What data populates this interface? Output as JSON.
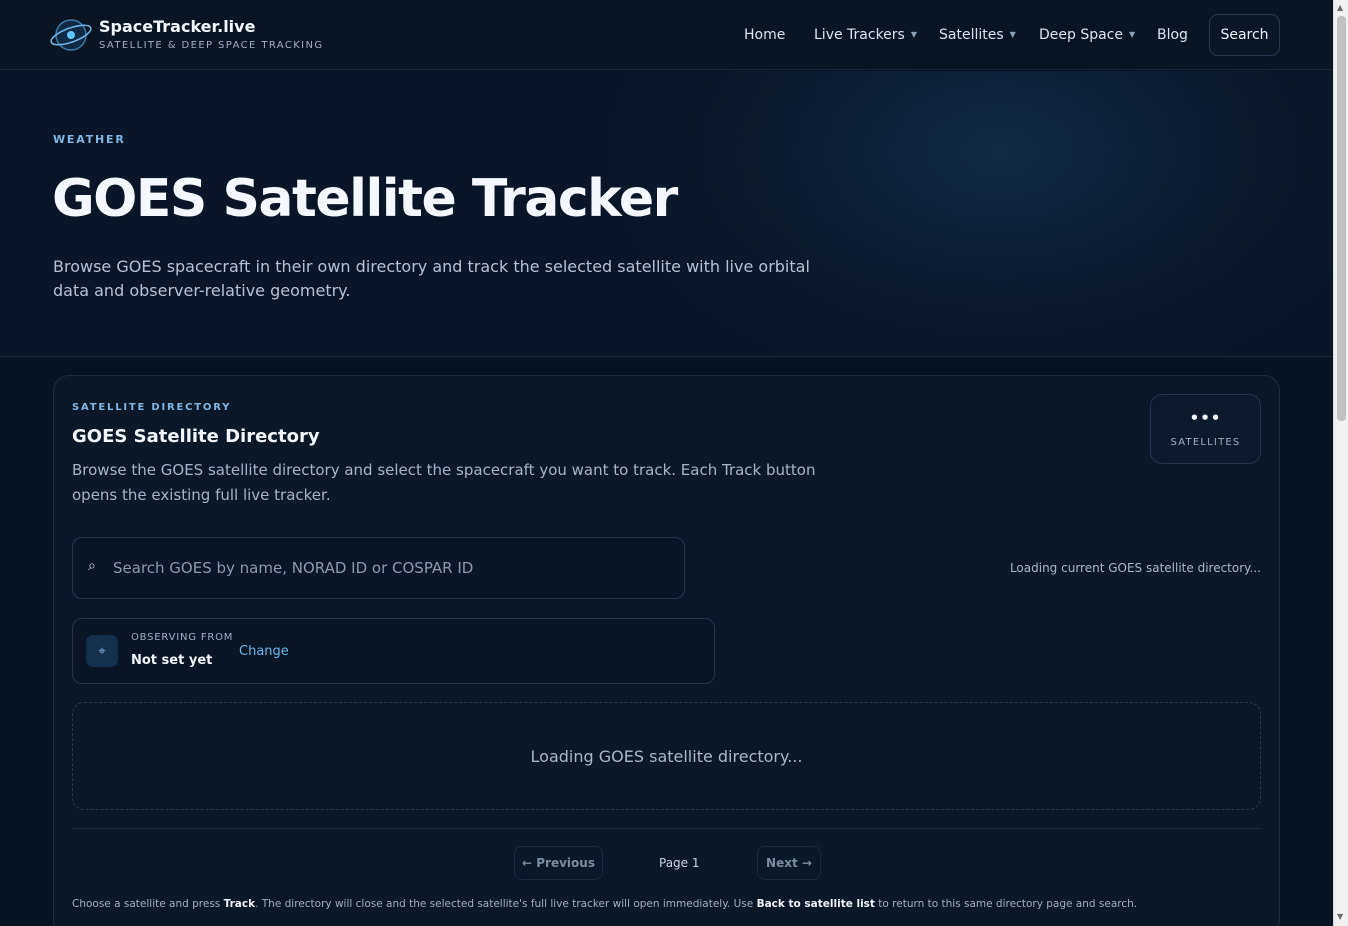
{
  "header": {
    "brand_name": "SpaceTracker.live",
    "brand_tagline": "SATELLITE & DEEP SPACE TRACKING",
    "nav": [
      {
        "label": "Home"
      },
      {
        "label": "Live Trackers",
        "dropdown": true
      },
      {
        "label": "Satellites",
        "dropdown": true
      },
      {
        "label": "Deep Space",
        "dropdown": true
      },
      {
        "label": "Blog"
      }
    ],
    "search_label": "Search"
  },
  "hero": {
    "eyebrow": "WEATHER",
    "title": "GOES Satellite Tracker",
    "description": "Browse GOES spacecraft in their own directory and track the selected satellite with live orbital data and observer-relative geometry."
  },
  "directory": {
    "eyebrow": "SATELLITE DIRECTORY",
    "title": "GOES Satellite Directory",
    "description": "Browse the GOES satellite directory and select the spacecraft you want to track. Each Track button opens the existing full live tracker.",
    "count_value": "•••",
    "count_label": "SATELLITES",
    "search_placeholder": "Search GOES by name, NORAD ID or COSPAR ID",
    "search_value": "",
    "status": "Loading current GOES satellite directory...",
    "observer_label": "OBSERVING FROM",
    "observer_value": "Not set yet",
    "observer_change": "Change",
    "loading_message": "Loading GOES satellite directory...",
    "pager": {
      "previous": "← Previous",
      "page": "Page 1",
      "next": "Next →"
    },
    "footnote": {
      "part1": "Choose a satellite and press ",
      "bold1": "Track",
      "part2": ". The directory will close and the selected satellite's full live tracker will open immediately. Use ",
      "bold2": "Back to satellite list",
      "part3": " to return to this same directory page and search."
    }
  },
  "icons": {
    "search": "search-icon",
    "observer": "crosshair-icon",
    "logo": "orbit-logo"
  },
  "colors": {
    "accent": "#7fb6e6",
    "link": "#6db4ef",
    "background": "#081322"
  }
}
